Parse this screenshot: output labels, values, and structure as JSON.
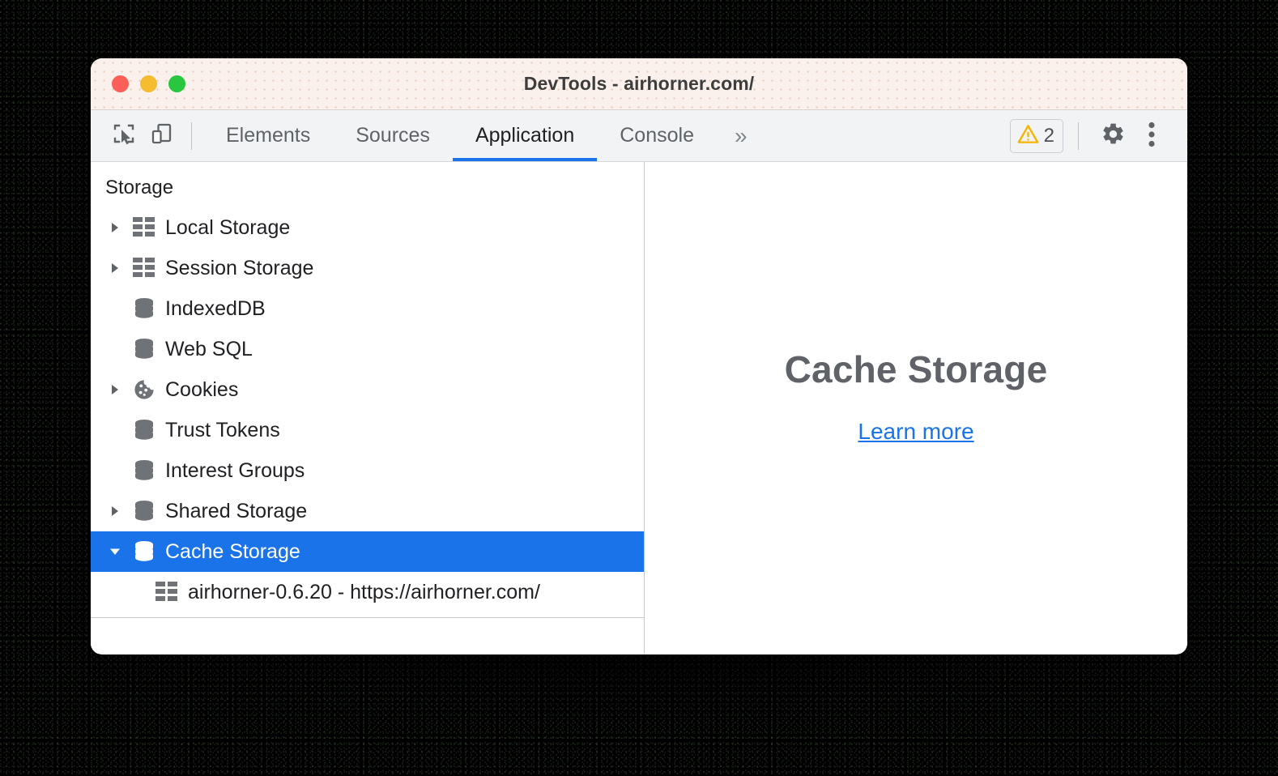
{
  "window": {
    "title": "DevTools - airhorner.com/",
    "traffic_lights": [
      {
        "name": "close",
        "color": "#fb5f57"
      },
      {
        "name": "minimize",
        "color": "#f5bc2f"
      },
      {
        "name": "zoom",
        "color": "#29c73f"
      }
    ]
  },
  "toolbar": {
    "inspect_icon": "inspect-element-icon",
    "device_icon": "device-toolbar-icon",
    "tabs": [
      {
        "label": "Elements",
        "active": false
      },
      {
        "label": "Sources",
        "active": false
      },
      {
        "label": "Application",
        "active": true
      },
      {
        "label": "Console",
        "active": false
      }
    ],
    "more_tabs_label": "»",
    "warning": {
      "icon": "warning-triangle-icon",
      "count": "2",
      "color": "#f5b400"
    },
    "settings_icon": "gear-icon",
    "menu_icon": "three-dot-menu-icon",
    "active_tab_underline_color": "#1a73e8"
  },
  "sidebar": {
    "section_title": "Storage",
    "selection_color": "#1a73e8",
    "items": [
      {
        "label": "Local Storage",
        "icon": "table-icon",
        "twisty": "collapsed",
        "selected": false,
        "child": false
      },
      {
        "label": "Session Storage",
        "icon": "table-icon",
        "twisty": "collapsed",
        "selected": false,
        "child": false
      },
      {
        "label": "IndexedDB",
        "icon": "database-icon",
        "twisty": "none",
        "selected": false,
        "child": false
      },
      {
        "label": "Web SQL",
        "icon": "database-icon",
        "twisty": "none",
        "selected": false,
        "child": false
      },
      {
        "label": "Cookies",
        "icon": "cookie-icon",
        "twisty": "collapsed",
        "selected": false,
        "child": false
      },
      {
        "label": "Trust Tokens",
        "icon": "database-icon",
        "twisty": "none",
        "selected": false,
        "child": false
      },
      {
        "label": "Interest Groups",
        "icon": "database-icon",
        "twisty": "none",
        "selected": false,
        "child": false
      },
      {
        "label": "Shared Storage",
        "icon": "database-icon",
        "twisty": "collapsed",
        "selected": false,
        "child": false
      },
      {
        "label": "Cache Storage",
        "icon": "database-icon",
        "twisty": "expanded",
        "selected": true,
        "child": false
      },
      {
        "label": "airhorner-0.6.20 - https://airhorner.com/",
        "icon": "table-icon",
        "twisty": "none",
        "selected": false,
        "child": true
      }
    ]
  },
  "detail": {
    "title": "Cache Storage",
    "link_label": "Learn more",
    "link_color": "#1a73e8"
  }
}
